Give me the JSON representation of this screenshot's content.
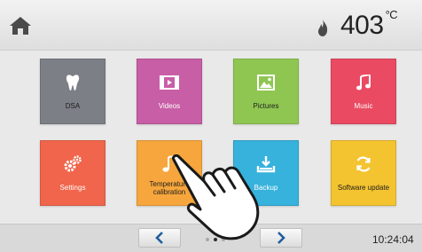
{
  "topbar": {
    "home_icon": "home-icon",
    "flame_icon": "flame-icon",
    "temperature_value": "403",
    "temperature_unit": "°C"
  },
  "tiles": [
    {
      "label": "DSA",
      "icon": "tooth-icon",
      "color": "#7c7f86"
    },
    {
      "label": "Videos",
      "icon": "video-icon",
      "color": "#c85ea6"
    },
    {
      "label": "Pictures",
      "icon": "picture-icon",
      "color": "#8fc652"
    },
    {
      "label": "Music",
      "icon": "music-note-icon",
      "color": "#ea4a62"
    },
    {
      "label": "Settings",
      "icon": "gears-icon",
      "color": "#f0654b"
    },
    {
      "label": "Temperature calibration",
      "icon": "calibration-icon",
      "color": "#f6a63c"
    },
    {
      "label": "Backup",
      "icon": "backup-icon",
      "color": "#36b2dc"
    },
    {
      "label": "Software update",
      "icon": "update-icon",
      "color": "#f4c330"
    }
  ],
  "bottombar": {
    "prev_icon": "chevron-left-icon",
    "next_icon": "chevron-right-icon",
    "page_dots": 3,
    "active_page": 2,
    "time": "10:24:04"
  },
  "overlay": {
    "icon": "pointing-hand-icon"
  }
}
